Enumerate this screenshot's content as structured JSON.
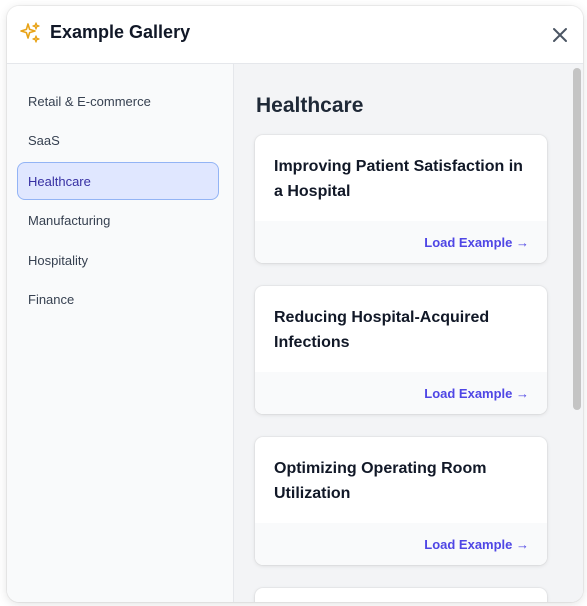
{
  "header": {
    "title": "Example Gallery",
    "icon": "sparkles-icon",
    "close_icon": "close-icon"
  },
  "sidebar": {
    "items": [
      {
        "label": "Retail & E-commerce",
        "active": false
      },
      {
        "label": "SaaS",
        "active": false
      },
      {
        "label": "Healthcare",
        "active": true
      },
      {
        "label": "Manufacturing",
        "active": false
      },
      {
        "label": "Hospitality",
        "active": false
      },
      {
        "label": "Finance",
        "active": false
      }
    ]
  },
  "main": {
    "section_title": "Healthcare",
    "cards": [
      {
        "title": "Improving Patient Satisfaction in a Hospital",
        "action": "Load Example →"
      },
      {
        "title": "Reducing Hospital-Acquired Infections",
        "action": "Load Example →"
      },
      {
        "title": "Optimizing Operating Room Utilization",
        "action": "Load Example →"
      }
    ]
  },
  "colors": {
    "accent": "#4f46e5",
    "active_bg": "#e0e7ff",
    "active_border": "#93b4f5",
    "sparkle": "#e8a317"
  }
}
